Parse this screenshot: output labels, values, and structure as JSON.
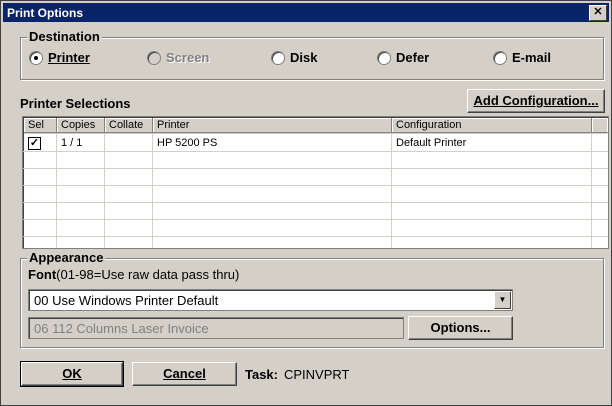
{
  "window": {
    "title": "Print Options",
    "close_glyph": "✕"
  },
  "destination": {
    "label": "Destination",
    "options": [
      {
        "label": "Printer",
        "checked": true,
        "disabled": false
      },
      {
        "label": "Screen",
        "checked": false,
        "disabled": true
      },
      {
        "label": "Disk",
        "checked": false,
        "disabled": false
      },
      {
        "label": "Defer",
        "checked": false,
        "disabled": false
      },
      {
        "label": "E-mail",
        "checked": false,
        "disabled": false
      }
    ]
  },
  "printer_selections": {
    "label": "Printer Selections",
    "add_button": "Add Configuration...",
    "columns": [
      "Sel",
      "Copies",
      "Collate",
      "Printer",
      "Configuration"
    ],
    "rows": [
      {
        "sel": "✓",
        "copies": "1 / 1",
        "collate": "",
        "printer": "HP 5200 PS",
        "configuration": "Default Printer"
      }
    ]
  },
  "appearance": {
    "label": "Appearance",
    "font_label": "Font",
    "font_hint": "(01-98=Use raw data pass thru)",
    "font_select": "00 Use Windows Printer Default",
    "secondary_field": "06 112 Columns Laser Invoice",
    "options_button": "Options..."
  },
  "footer": {
    "ok": "OK",
    "cancel": "Cancel",
    "task_label": "Task:",
    "task_value": "CPINVPRT"
  },
  "colors": {
    "titlebar": "#0a246a",
    "face": "#d4d0c8"
  }
}
